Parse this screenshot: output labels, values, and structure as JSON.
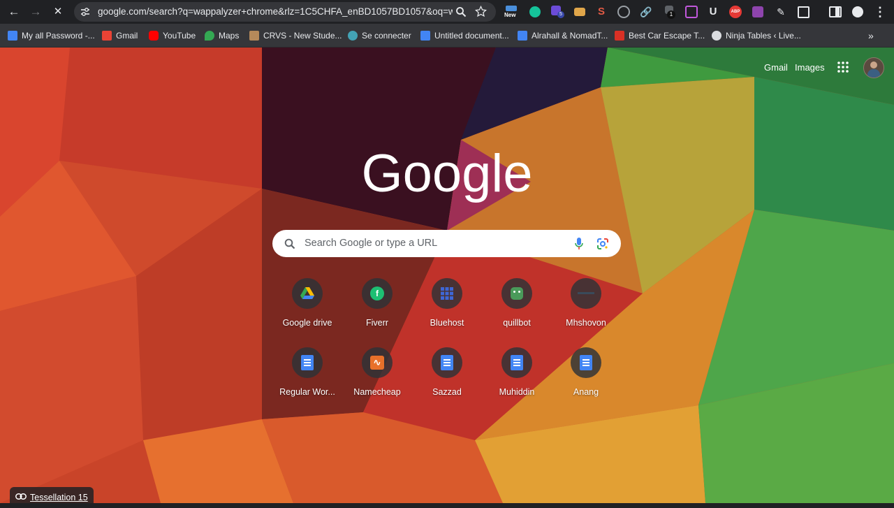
{
  "browser": {
    "url": "google.com/search?q=wappalyzer+chrome&rlz=1C5CHFA_enBD1057BD1057&oq=w...",
    "reload_state": "stop",
    "extensions": [
      "new-badge-extension",
      "grammarly-icon",
      "extension-badge-5",
      "extension-icon",
      "scribe-icon",
      "wordpress-icon",
      "link-icon",
      "extension-badge-1",
      "extension-icon",
      "unicheck-icon",
      "adblock-plus-icon",
      "extension-icon",
      "extension-icon",
      "puzzle-icon"
    ],
    "extension_badges": {
      "new": "New",
      "count_1": "1",
      "count_5": "5",
      "abp": "ABP",
      "u": "U"
    }
  },
  "bookmarks": [
    {
      "label": "My all Password -...",
      "icon": "docs-icon",
      "color": "#4285f4"
    },
    {
      "label": "Gmail",
      "icon": "gmail-icon",
      "color": "#ea4335"
    },
    {
      "label": "YouTube",
      "icon": "youtube-icon",
      "color": "#ff0000"
    },
    {
      "label": "Maps",
      "icon": "maps-icon",
      "color": "#34a853"
    },
    {
      "label": "CRVS - New Stude...",
      "icon": "crvs-icon",
      "color": "#b5895a"
    },
    {
      "label": "Se connecter",
      "icon": "connect-icon",
      "color": "#43a3b5"
    },
    {
      "label": "Untitled document...",
      "icon": "docs-icon",
      "color": "#4285f4"
    },
    {
      "label": "Alrahall & NomadT...",
      "icon": "docs-icon",
      "color": "#4285f4"
    },
    {
      "label": "Best Car Escape T...",
      "icon": "game-icon",
      "color": "#d93025"
    },
    {
      "label": "Ninja Tables ‹ Live...",
      "icon": "wordpress-icon",
      "color": "#dadce0"
    }
  ],
  "ntp": {
    "gmail": "Gmail",
    "images": "Images",
    "logo": "Google",
    "search_placeholder": "Search Google or type a URL",
    "shortcuts": [
      {
        "label": "Google drive",
        "icon": "google-drive-icon"
      },
      {
        "label": "Fiverr",
        "icon": "fiverr-icon"
      },
      {
        "label": "Bluehost",
        "icon": "bluehost-icon"
      },
      {
        "label": "quillbot",
        "icon": "quillbot-icon"
      },
      {
        "label": "Mhshovon",
        "icon": "mhshovon-icon"
      },
      {
        "label": "Regular Wor...",
        "icon": "docs-icon"
      },
      {
        "label": "Namecheap",
        "icon": "namecheap-icon"
      },
      {
        "label": "Sazzad",
        "icon": "docs-icon"
      },
      {
        "label": "Muhiddin",
        "icon": "docs-icon"
      },
      {
        "label": "Anang",
        "icon": "docs-icon"
      }
    ],
    "attribution": "Tessellation 15"
  }
}
